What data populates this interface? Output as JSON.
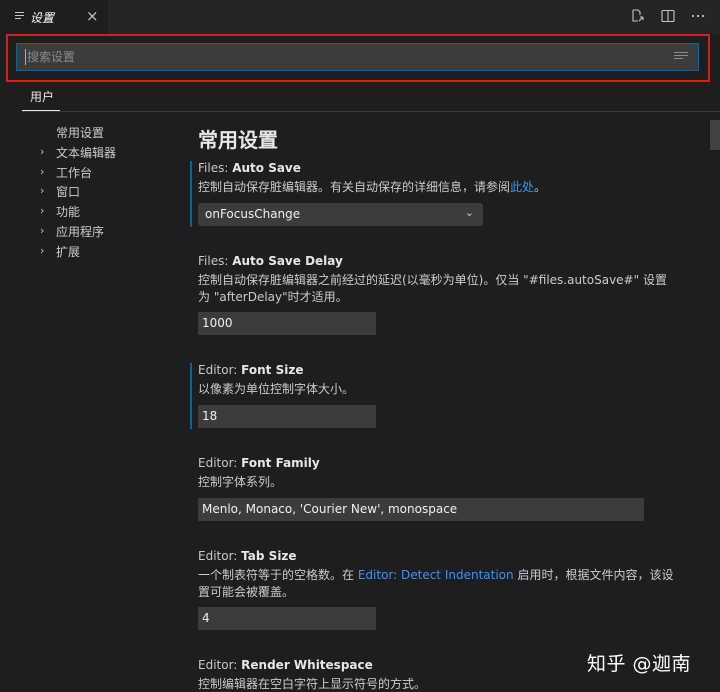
{
  "tab": {
    "title": "设置"
  },
  "search": {
    "placeholder": "搜索设置"
  },
  "scope_tabs": {
    "user": "用户"
  },
  "toc": [
    {
      "label": "常用设置",
      "expandable": false
    },
    {
      "label": "文本编辑器",
      "expandable": true
    },
    {
      "label": "工作台",
      "expandable": true
    },
    {
      "label": "窗口",
      "expandable": true
    },
    {
      "label": "功能",
      "expandable": true
    },
    {
      "label": "应用程序",
      "expandable": true
    },
    {
      "label": "扩展",
      "expandable": true
    }
  ],
  "section_title": "常用设置",
  "settings": {
    "auto_save": {
      "category": "Files: ",
      "key": "Auto Save",
      "desc": "控制自动保存脏编辑器。有关自动保存的详细信息，请参阅",
      "link": "此处",
      "desc_end": "。",
      "value": "onFocusChange"
    },
    "auto_save_delay": {
      "category": "Files: ",
      "key": "Auto Save Delay",
      "desc": "控制自动保存脏编辑器之前经过的延迟(以毫秒为单位)。仅当 \"#files.autoSave#\" 设置为 \"afterDelay\"时才适用。",
      "value": "1000"
    },
    "font_size": {
      "category": "Editor: ",
      "key": "Font Size",
      "desc": "以像素为单位控制字体大小。",
      "value": "18"
    },
    "font_family": {
      "category": "Editor: ",
      "key": "Font Family",
      "desc": "控制字体系列。",
      "value": "Menlo, Monaco, 'Courier New', monospace"
    },
    "tab_size": {
      "category": "Editor: ",
      "key": "Tab Size",
      "desc_pre": "一个制表符等于的空格数。在 ",
      "link": "Editor: Detect Indentation",
      "desc_post": " 启用时，根据文件内容，该设置可能会被覆盖。",
      "value": "4"
    },
    "render_whitespace": {
      "category": "Editor: ",
      "key": "Render Whitespace",
      "desc": "控制编辑器在空白字符上显示符号的方式。"
    }
  },
  "watermark": "知乎 @迦南",
  "icons": {
    "tab": "menu-lines-icon",
    "close": "close-icon",
    "open_json": "open-settings-json-icon",
    "split": "split-editor-icon",
    "more": "more-actions-icon",
    "clear": "clear-filter-icon"
  },
  "colors": {
    "accent": "#0e639c",
    "link": "#3794ff",
    "highlight_frame": "#d12020"
  }
}
